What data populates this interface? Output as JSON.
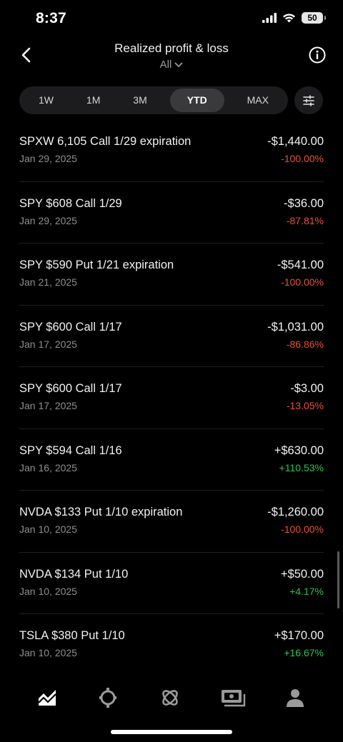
{
  "status": {
    "time": "8:37",
    "battery": "50"
  },
  "header": {
    "title": "Realized profit & loss",
    "filter_value": "All"
  },
  "periods": [
    {
      "label": "1W",
      "active": false
    },
    {
      "label": "1M",
      "active": false
    },
    {
      "label": "3M",
      "active": false
    },
    {
      "label": "YTD",
      "active": true
    },
    {
      "label": "MAX",
      "active": false
    }
  ],
  "trades": [
    {
      "name": "SPXW 6,105 Call 1/29 expiration",
      "date": "Jan 29, 2025",
      "amount": "-$1,440.00",
      "pct": "-100.00%",
      "direction": "neg"
    },
    {
      "name": "SPY $608 Call 1/29",
      "date": "Jan 29, 2025",
      "amount": "-$36.00",
      "pct": "-87.81%",
      "direction": "neg"
    },
    {
      "name": "SPY $590 Put 1/21 expiration",
      "date": "Jan 21, 2025",
      "amount": "-$541.00",
      "pct": "-100.00%",
      "direction": "neg"
    },
    {
      "name": "SPY $600 Call 1/17",
      "date": "Jan 17, 2025",
      "amount": "-$1,031.00",
      "pct": "-86.86%",
      "direction": "neg"
    },
    {
      "name": "SPY $600 Call 1/17",
      "date": "Jan 17, 2025",
      "amount": "-$3.00",
      "pct": "-13.05%",
      "direction": "neg"
    },
    {
      "name": "SPY $594 Call 1/16",
      "date": "Jan 16, 2025",
      "amount": "+$630.00",
      "pct": "+110.53%",
      "direction": "pos"
    },
    {
      "name": "NVDA $133 Put 1/10 expiration",
      "date": "Jan 10, 2025",
      "amount": "-$1,260.00",
      "pct": "-100.00%",
      "direction": "neg"
    },
    {
      "name": "NVDA $134 Put 1/10",
      "date": "Jan 10, 2025",
      "amount": "+$50.00",
      "pct": "+4.17%",
      "direction": "pos"
    },
    {
      "name": "TSLA $380 Put 1/10",
      "date": "Jan 10, 2025",
      "amount": "+$170.00",
      "pct": "+16.67%",
      "direction": "pos"
    }
  ],
  "colors": {
    "negative": "#e8503a",
    "positive": "#2fc14e",
    "background": "#000000"
  },
  "tabbar": [
    {
      "icon": "investing-chart-icon"
    },
    {
      "icon": "crypto-icon"
    },
    {
      "icon": "strategies-icon"
    },
    {
      "icon": "cash-card-icon"
    },
    {
      "icon": "account-person-icon"
    }
  ]
}
